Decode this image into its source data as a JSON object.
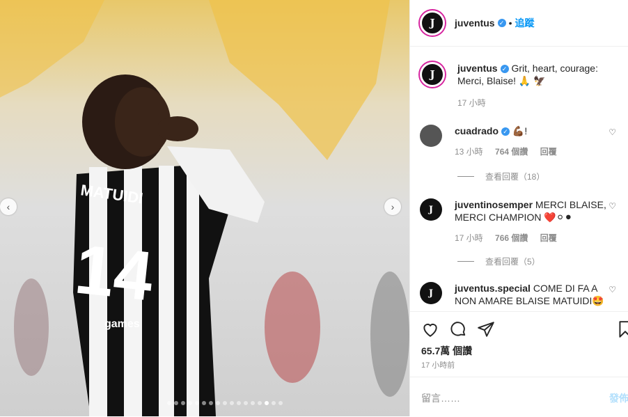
{
  "post": {
    "username": "juventus",
    "follow_label": "追蹤",
    "caption_user": "juventus",
    "caption_text": "Grit, heart, courage: Merci, Blaise! 🙏 🦅",
    "caption_time": "17 小時",
    "likes": "65.7萬 個讚",
    "posted_time": "17 小時前",
    "comment_placeholder": "留言……",
    "post_button": "發佈",
    "jersey_name": "MATUIDI",
    "jersey_number": "14",
    "sponsor": "games"
  },
  "comments": [
    {
      "user": "cuadrado",
      "text": "💪🏾!",
      "time": "13 小時",
      "likes": "764 個讚",
      "reply": "回覆",
      "view_replies": "查看回覆（18）"
    },
    {
      "user": "juventinosemper",
      "text": "MERCI BLAISE, MERCI CHAMPION ❤️⚪⚫",
      "time": "17 小時",
      "likes": "766 個讚",
      "reply": "回覆",
      "view_replies": "查看回覆（5）"
    },
    {
      "user": "juventus.special",
      "text": "COME DI FA A NON AMARE BLAISE MATUIDI🤩"
    }
  ],
  "icons": {
    "verified": "verified-badge-icon",
    "like": "heart-icon",
    "comment": "comment-icon",
    "share": "send-icon",
    "save": "bookmark-icon",
    "prev": "chevron-left-icon",
    "next": "chevron-right-icon"
  },
  "colors": {
    "link_blue": "#0095f6",
    "verified_blue": "#3897f0",
    "secondary_text": "#8e8e8e"
  }
}
